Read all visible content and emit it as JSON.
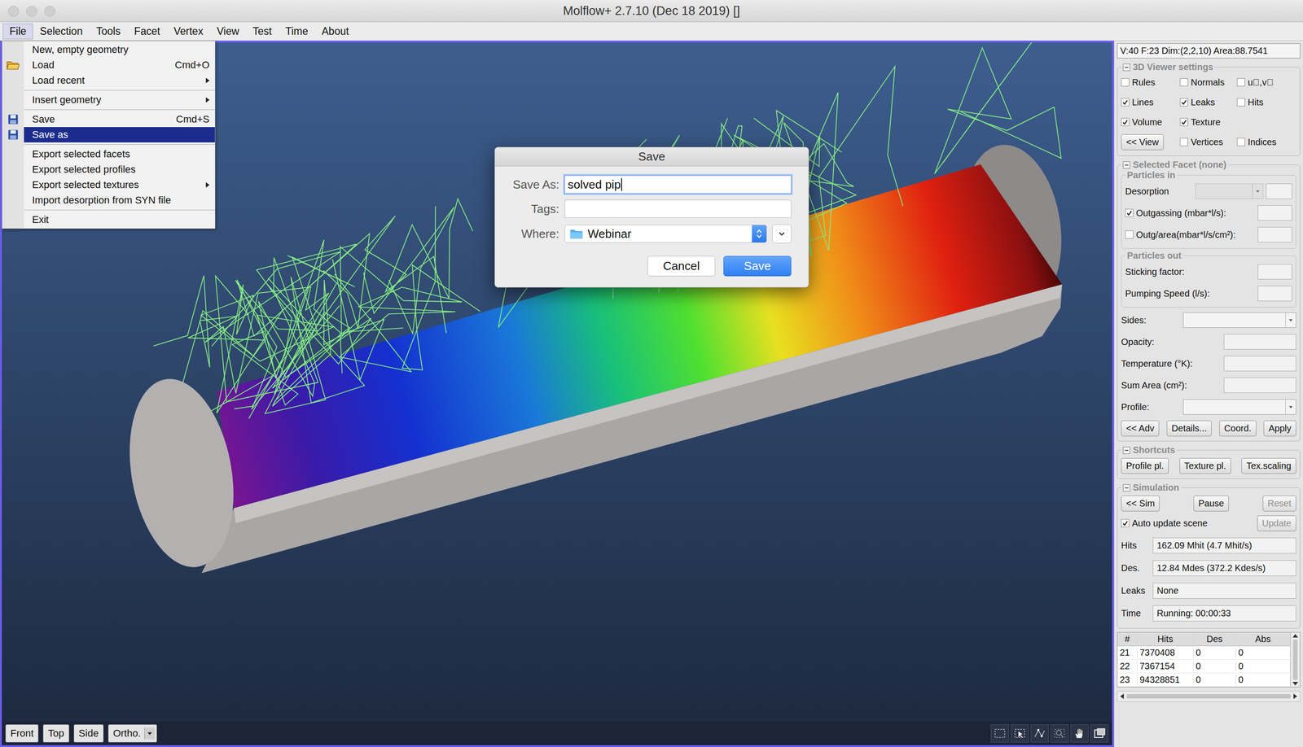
{
  "window": {
    "title": "Molflow+ 2.7.10 (Dec 18 2019) []"
  },
  "menu_bar": [
    {
      "label": "File",
      "selected": true
    },
    {
      "label": "Selection",
      "selected": false
    },
    {
      "label": "Tools",
      "selected": false
    },
    {
      "label": "Facet",
      "selected": false
    },
    {
      "label": "Vertex",
      "selected": false
    },
    {
      "label": "View",
      "selected": false
    },
    {
      "label": "Test",
      "selected": false
    },
    {
      "label": "Time",
      "selected": false
    },
    {
      "label": "About",
      "selected": false
    }
  ],
  "file_menu": [
    {
      "kind": "item",
      "label": "New, empty geometry",
      "shortcut": "",
      "submenu": false,
      "has_icon": false,
      "selected": false
    },
    {
      "kind": "item",
      "label": "Load",
      "shortcut": "Cmd+O",
      "submenu": false,
      "has_icon": true,
      "selected": false
    },
    {
      "kind": "item",
      "label": "Load recent",
      "shortcut": "",
      "submenu": true,
      "has_icon": false,
      "selected": false
    },
    {
      "kind": "separator"
    },
    {
      "kind": "item",
      "label": "Insert geometry",
      "shortcut": "",
      "submenu": true,
      "has_icon": false,
      "selected": false
    },
    {
      "kind": "separator"
    },
    {
      "kind": "item",
      "label": "Save",
      "shortcut": "Cmd+S",
      "submenu": false,
      "has_icon": true,
      "selected": false
    },
    {
      "kind": "item",
      "label": "Save as",
      "shortcut": "",
      "submenu": false,
      "has_icon": true,
      "selected": true
    },
    {
      "kind": "separator"
    },
    {
      "kind": "item",
      "label": "Export selected facets",
      "shortcut": "",
      "submenu": false,
      "has_icon": false,
      "selected": false
    },
    {
      "kind": "item",
      "label": "Export selected profiles",
      "shortcut": "",
      "submenu": false,
      "has_icon": false,
      "selected": false
    },
    {
      "kind": "item",
      "label": "Export selected textures",
      "shortcut": "",
      "submenu": true,
      "has_icon": false,
      "selected": false
    },
    {
      "kind": "item",
      "label": "Import desorption from SYN file",
      "shortcut": "",
      "submenu": false,
      "has_icon": false,
      "selected": false
    },
    {
      "kind": "separator"
    },
    {
      "kind": "item",
      "label": "Exit",
      "shortcut": "",
      "submenu": false,
      "has_icon": false,
      "selected": false
    }
  ],
  "viewer_toolbar": {
    "buttons": [
      "Front",
      "Top",
      "Side"
    ],
    "projection": "Ortho."
  },
  "dialog": {
    "title": "Save",
    "fields": [
      {
        "label": "Save As:",
        "value": "solved pip",
        "focused": true
      },
      {
        "label": "Tags:",
        "value": "",
        "focused": false
      }
    ],
    "where": {
      "label": "Where:",
      "value": "Webinar"
    },
    "buttons": [
      {
        "label": "Cancel",
        "default": false
      },
      {
        "label": "Save",
        "default": true
      }
    ]
  },
  "side_panel": {
    "info": "V:40 F:23 Dim:(2,2,10) Area:88.7541",
    "viewer_settings": {
      "title": "3D Viewer settings",
      "rows": [
        [
          {
            "kind": "check",
            "label": "Rules",
            "checked": false
          },
          {
            "kind": "check",
            "label": "Normals",
            "checked": false
          },
          {
            "kind": "check",
            "label": "u⃗,v⃗",
            "checked": false
          }
        ],
        [
          {
            "kind": "check",
            "label": "Lines",
            "checked": true
          },
          {
            "kind": "check",
            "label": "Leaks",
            "checked": true
          },
          {
            "kind": "check",
            "label": "Hits",
            "checked": false
          }
        ],
        [
          {
            "kind": "check",
            "label": "Volume",
            "checked": true
          },
          {
            "kind": "check",
            "label": "Texture",
            "checked": true
          }
        ],
        [
          {
            "kind": "button",
            "label": "<< View"
          },
          {
            "kind": "check",
            "label": "Vertices",
            "checked": false
          },
          {
            "kind": "check",
            "label": "Indices",
            "checked": false
          }
        ]
      ]
    },
    "selected_facet": {
      "title": "Selected Facet (none)",
      "particles_in": {
        "title": "Particles in",
        "desorption": {
          "label": "Desorption",
          "disabled": true
        },
        "outgassing": {
          "label": "Outgassing (mbar*l/s):",
          "checked": true
        },
        "outgassing_area": {
          "label": "Outg/area(mbar*l/s/cm²):",
          "checked": false
        }
      },
      "particles_out": {
        "title": "Particles out",
        "fields": [
          "Sticking factor:",
          "Pumping Speed (l/s):"
        ]
      },
      "fields": [
        {
          "kind": "dropdown",
          "label": "Sides:"
        },
        {
          "kind": "input",
          "label": "Opacity:"
        },
        {
          "kind": "input",
          "label": "Temperature (°K):"
        },
        {
          "kind": "input",
          "label": "Sum Area (cm²):"
        },
        {
          "kind": "dropdown",
          "label": "Profile:"
        }
      ],
      "buttons": [
        "<< Adv",
        "Details...",
        "Coord.",
        "Apply"
      ]
    },
    "shortcuts": {
      "title": "Shortcuts",
      "buttons": [
        "Profile pl.",
        "Texture pl.",
        "Tex.scaling"
      ]
    },
    "simulation": {
      "title": "Simulation",
      "buttons": [
        {
          "label": "<< Sim",
          "disabled": false
        },
        {
          "label": "Pause",
          "disabled": false
        },
        {
          "label": "Reset",
          "disabled": true
        }
      ],
      "auto_update": {
        "label": "Auto update scene",
        "checked": true
      },
      "update_button": {
        "label": "Update",
        "disabled": true
      },
      "stats": [
        {
          "label": "Hits",
          "value": "162.09 Mhit (4.7 Mhit/s)"
        },
        {
          "label": "Des.",
          "value": "12.84 Mdes (372.2 Kdes/s)"
        },
        {
          "label": "Leaks",
          "value": "None"
        },
        {
          "label": "Time",
          "value": "Running: 00:00:33"
        }
      ]
    },
    "facet_table": {
      "columns": [
        "#",
        "Hits",
        "Des",
        "Abs"
      ],
      "rows": [
        [
          "21",
          "7370408",
          "0",
          "0"
        ],
        [
          "22",
          "7367154",
          "0",
          "0"
        ],
        [
          "23",
          "94328851",
          "0",
          "0"
        ]
      ]
    }
  }
}
